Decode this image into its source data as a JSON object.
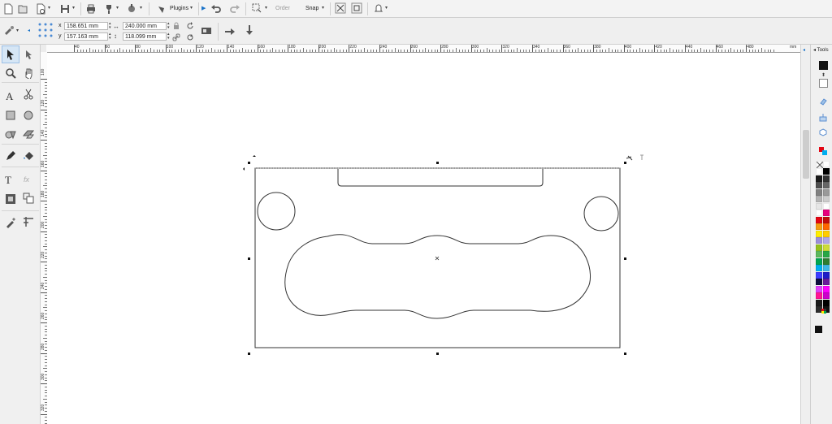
{
  "toolbar1": {
    "plugins_label": "Plugins",
    "order_label": "Order",
    "snap_label": "Snap"
  },
  "property_bar": {
    "x_label": "x",
    "y_label": "y",
    "x_value": "158.651 mm",
    "y_value": "157.163 mm",
    "width_value": "240.000 mm",
    "height_value": "118.099 mm"
  },
  "rulers": {
    "unit": "mm",
    "horizontal_ticks": [
      "40",
      "60",
      "80",
      "100",
      "120",
      "140",
      "160",
      "180",
      "200",
      "220",
      "240",
      "260",
      "280",
      "300",
      "320",
      "340",
      "360",
      "380",
      "400",
      "420",
      "440",
      "460",
      "480"
    ],
    "vertical_ticks": [
      "100",
      "120",
      "140",
      "160",
      "180",
      "200",
      "220",
      "240",
      "260",
      "280",
      "300",
      "320"
    ]
  },
  "right_panel": {
    "tools_label": "Tools"
  },
  "palette": {
    "colors": [
      "#ffffff",
      "#000000",
      "#1a1a1a",
      "#333333",
      "#4d4d4d",
      "#666666",
      "#808080",
      "#999999",
      "#b3b3b3",
      "#cccccc",
      "#e6e6e6",
      "#ffffff",
      "#ffffff",
      "#e6007e",
      "#e30613",
      "#c00d0d",
      "#f39c12",
      "#ff6600",
      "#ffed00",
      "#ffcc00",
      "#9c8edb",
      "#b0a7e6",
      "#95c11f",
      "#cddc39",
      "#5cb85c",
      "#28a745",
      "#00a650",
      "#2e7d32",
      "#00aeef",
      "#3fb7e6",
      "#3c3cff",
      "#1d1dc7",
      "#0d0d3d",
      "#6a1b9a",
      "#e040fb",
      "#ff00ff",
      "#ff1493",
      "#cc00cc",
      "#1a1a1a",
      "#000000",
      "#2b2b2b",
      "#111111"
    ]
  },
  "colors": {
    "accent": "#1a73c8",
    "canvas": "#ffffff",
    "shape_stroke": "#333333"
  }
}
